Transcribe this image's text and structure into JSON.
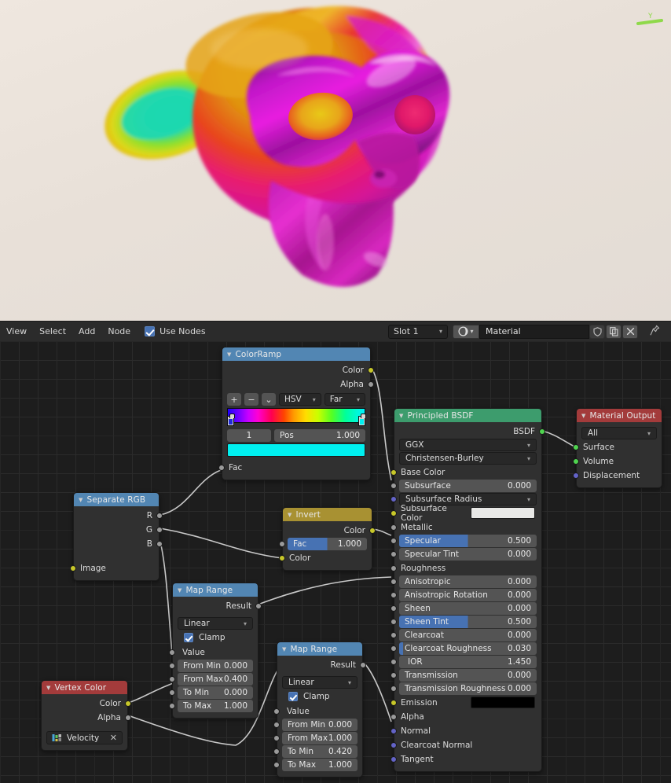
{
  "viewport": {
    "name": "3d-viewport",
    "gizmo_axis_label": "Y",
    "gizmo_axis_color": "#8fd94a",
    "background_color": "#e8e0d8"
  },
  "header": {
    "menus": [
      "View",
      "Select",
      "Add",
      "Node"
    ],
    "use_nodes_label": "Use Nodes",
    "use_nodes_checked": true,
    "slot_value": "Slot 1",
    "material_name": "Material",
    "shield_icon": "shield-icon",
    "copy_icon": "copy-icon",
    "close_icon": "x-icon",
    "pin_icon": "pin-icon",
    "browse_material_icon": "material-sphere-icon"
  },
  "nodes": {
    "color_ramp": {
      "title": "ColorRamp",
      "header_color": "#5286b3",
      "outputs": [
        {
          "label": "Color",
          "color": "#c7c729"
        },
        {
          "label": "Alpha",
          "color": "#9a9a9a"
        }
      ],
      "tools": {
        "add": "+",
        "remove": "−",
        "menu": "⌄"
      },
      "interpolation": "HSV",
      "hue_mode": "Far",
      "index_value": "1",
      "pos_label": "Pos",
      "pos_value": "1.000",
      "selected_color": "#00efef",
      "inputs": [
        {
          "label": "Fac",
          "color": "#9a9a9a"
        }
      ]
    },
    "separate_rgb": {
      "title": "Separate RGB",
      "header_color": "#5286b3",
      "outputs": [
        {
          "label": "R",
          "color": "#9a9a9a"
        },
        {
          "label": "G",
          "color": "#9a9a9a"
        },
        {
          "label": "B",
          "color": "#9a9a9a"
        }
      ],
      "inputs": [
        {
          "label": "Image",
          "color": "#c7c729"
        }
      ]
    },
    "invert": {
      "title": "Invert",
      "header_color": "#a89132",
      "outputs": [
        {
          "label": "Color",
          "color": "#c7c729"
        }
      ],
      "fac_label": "Fac",
      "fac_value": "1.000",
      "inputs": [
        {
          "label": "Color",
          "color": "#c7c729"
        }
      ]
    },
    "map_range_1": {
      "title": "Map Range",
      "header_color": "#5286b3",
      "output_label": "Result",
      "output_color": "#9a9a9a",
      "interpolation": "Linear",
      "clamp_label": "Clamp",
      "clamp_checked": true,
      "value_label": "Value",
      "fields": [
        {
          "label": "From Min",
          "value": "0.000"
        },
        {
          "label": "From Max",
          "value": "0.400"
        },
        {
          "label": "To Min",
          "value": "0.000"
        },
        {
          "label": "To Max",
          "value": "1.000"
        }
      ]
    },
    "map_range_2": {
      "title": "Map Range",
      "header_color": "#5286b3",
      "output_label": "Result",
      "output_color": "#9a9a9a",
      "interpolation": "Linear",
      "clamp_label": "Clamp",
      "clamp_checked": true,
      "value_label": "Value",
      "fields": [
        {
          "label": "From Min",
          "value": "0.000"
        },
        {
          "label": "From Max",
          "value": "1.000"
        },
        {
          "label": "To Min",
          "value": "0.420"
        },
        {
          "label": "To Max",
          "value": "1.000"
        }
      ]
    },
    "vertex_color": {
      "title": "Vertex Color",
      "header_color": "#a33b3b",
      "outputs": [
        {
          "label": "Color",
          "color": "#c7c729"
        },
        {
          "label": "Alpha",
          "color": "#9a9a9a"
        }
      ],
      "attribute_value": "Velocity",
      "attribute_icon": "vertex-color-icon",
      "clear_icon": "x-icon"
    },
    "principled_bsdf": {
      "title": "Principled BSDF",
      "header_color": "#3d9c6d",
      "output_label": "BSDF",
      "output_color": "#4fd44f",
      "distribution": "GGX",
      "subsurface_method": "Christensen-Burley",
      "sockets": [
        {
          "label": "Base Color",
          "color": "#c7c729",
          "kind": "plain"
        },
        {
          "label": "Subsurface",
          "color": "#9a9a9a",
          "kind": "value",
          "value": "0.000"
        },
        {
          "label": "Subsurface Radius",
          "color": "#6363c7",
          "kind": "enum"
        },
        {
          "label": "Subsurface Color",
          "color": "#c7c729",
          "kind": "swatch",
          "swatch_color": "#e8e8e6"
        },
        {
          "label": "Metallic",
          "color": "#9a9a9a",
          "kind": "plain"
        },
        {
          "label": "Specular",
          "color": "#9a9a9a",
          "kind": "slider",
          "value": "0.500",
          "fill": 50
        },
        {
          "label": "Specular Tint",
          "color": "#9a9a9a",
          "kind": "value",
          "value": "0.000"
        },
        {
          "label": "Roughness",
          "color": "#9a9a9a",
          "kind": "plain"
        },
        {
          "label": "Anisotropic",
          "color": "#9a9a9a",
          "kind": "value",
          "value": "0.000"
        },
        {
          "label": "Anisotropic Rotation",
          "color": "#9a9a9a",
          "kind": "value",
          "value": "0.000"
        },
        {
          "label": "Sheen",
          "color": "#9a9a9a",
          "kind": "value",
          "value": "0.000"
        },
        {
          "label": "Sheen Tint",
          "color": "#9a9a9a",
          "kind": "slider",
          "value": "0.500",
          "fill": 50
        },
        {
          "label": "Clearcoat",
          "color": "#9a9a9a",
          "kind": "value",
          "value": "0.000"
        },
        {
          "label": "Clearcoat Roughness",
          "color": "#9a9a9a",
          "kind": "slider",
          "value": "0.030",
          "fill": 3
        },
        {
          "label": "IOR",
          "color": "#9a9a9a",
          "kind": "value",
          "value": "1.450"
        },
        {
          "label": "Transmission",
          "color": "#9a9a9a",
          "kind": "value",
          "value": "0.000"
        },
        {
          "label": "Transmission Roughness",
          "color": "#9a9a9a",
          "kind": "value",
          "value": "0.000"
        },
        {
          "label": "Emission",
          "color": "#c7c729",
          "kind": "swatch",
          "swatch_color": "#000000"
        },
        {
          "label": "Alpha",
          "color": "#9a9a9a",
          "kind": "plain"
        },
        {
          "label": "Normal",
          "color": "#6363c7",
          "kind": "plain"
        },
        {
          "label": "Clearcoat Normal",
          "color": "#6363c7",
          "kind": "plain"
        },
        {
          "label": "Tangent",
          "color": "#6363c7",
          "kind": "plain"
        }
      ]
    },
    "material_output": {
      "title": "Material Output",
      "header_color": "#a33b3b",
      "target": "All",
      "inputs": [
        {
          "label": "Surface",
          "color": "#4fd44f"
        },
        {
          "label": "Volume",
          "color": "#4fd44f"
        },
        {
          "label": "Displacement",
          "color": "#6363c7"
        }
      ]
    }
  }
}
